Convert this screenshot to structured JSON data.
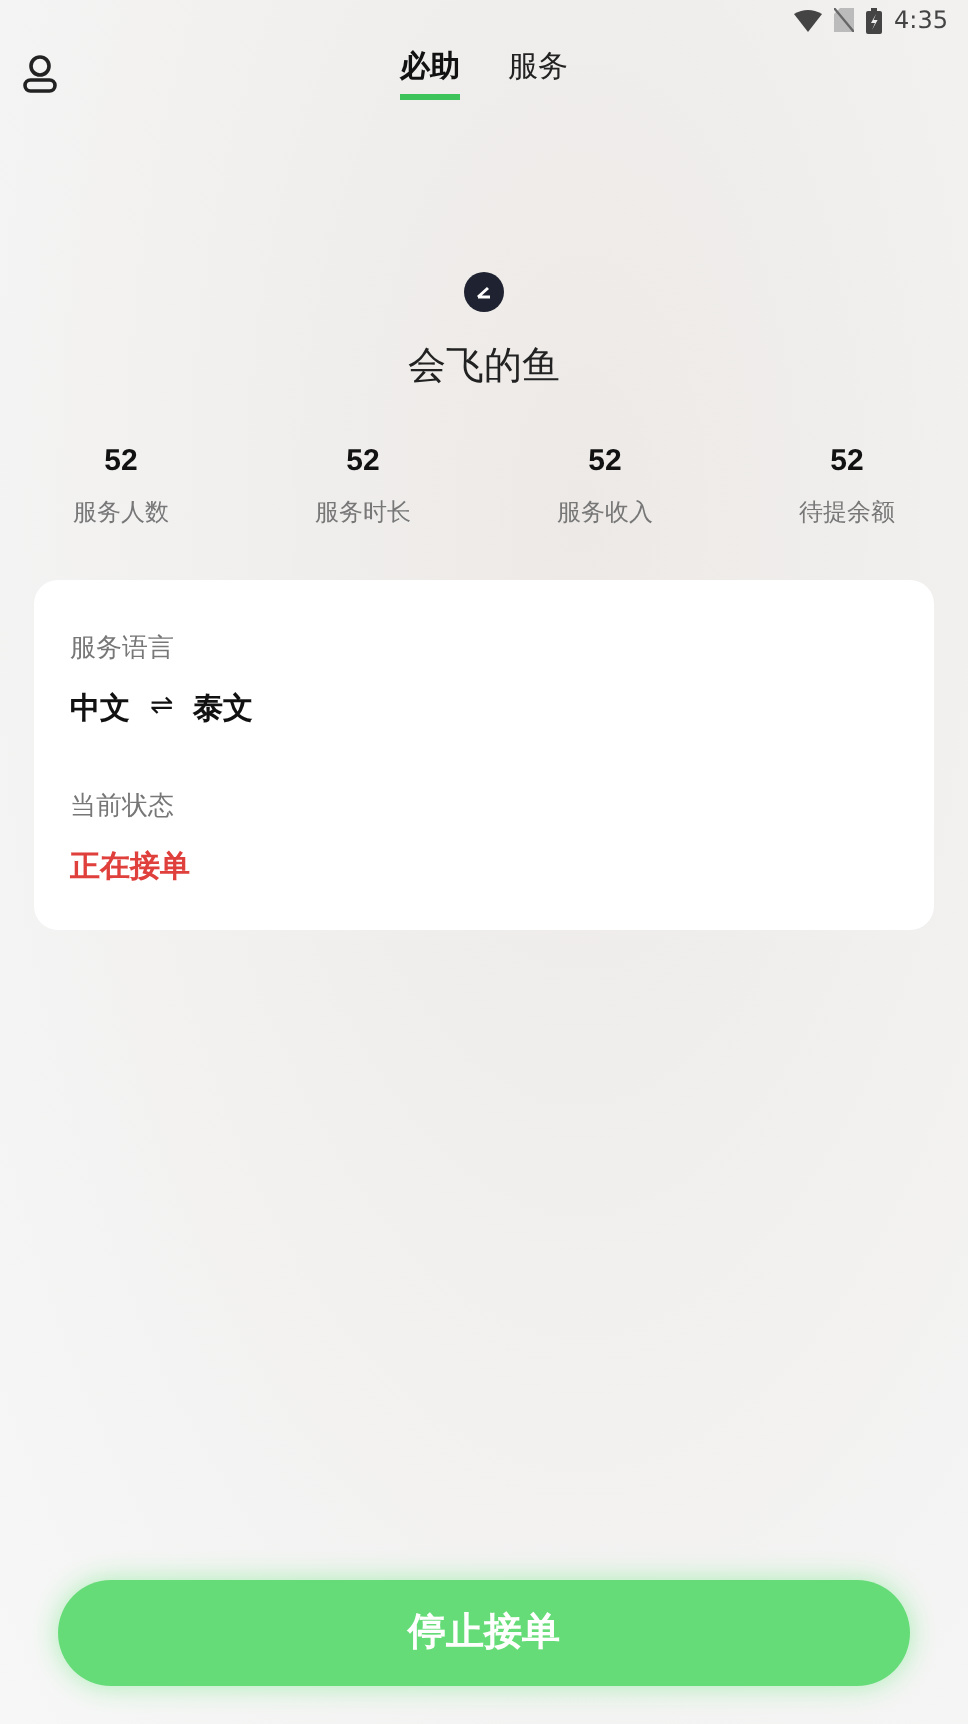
{
  "status_bar": {
    "time": "4:35"
  },
  "tabs": [
    {
      "label": "必助",
      "selected": true
    },
    {
      "label": "服务",
      "selected": false
    }
  ],
  "profile": {
    "name": "会飞的鱼"
  },
  "stats": [
    {
      "value": "52",
      "label": "服务人数"
    },
    {
      "value": "52",
      "label": "服务时长"
    },
    {
      "value": "52",
      "label": "服务收入"
    },
    {
      "value": "52",
      "label": "待提余额"
    }
  ],
  "card": {
    "language_label": "服务语言",
    "from_language": "中文",
    "swap_symbol": "⇌",
    "to_language": "泰文",
    "status_label": "当前状态",
    "status": "正在接单"
  },
  "action_button": "停止接单"
}
